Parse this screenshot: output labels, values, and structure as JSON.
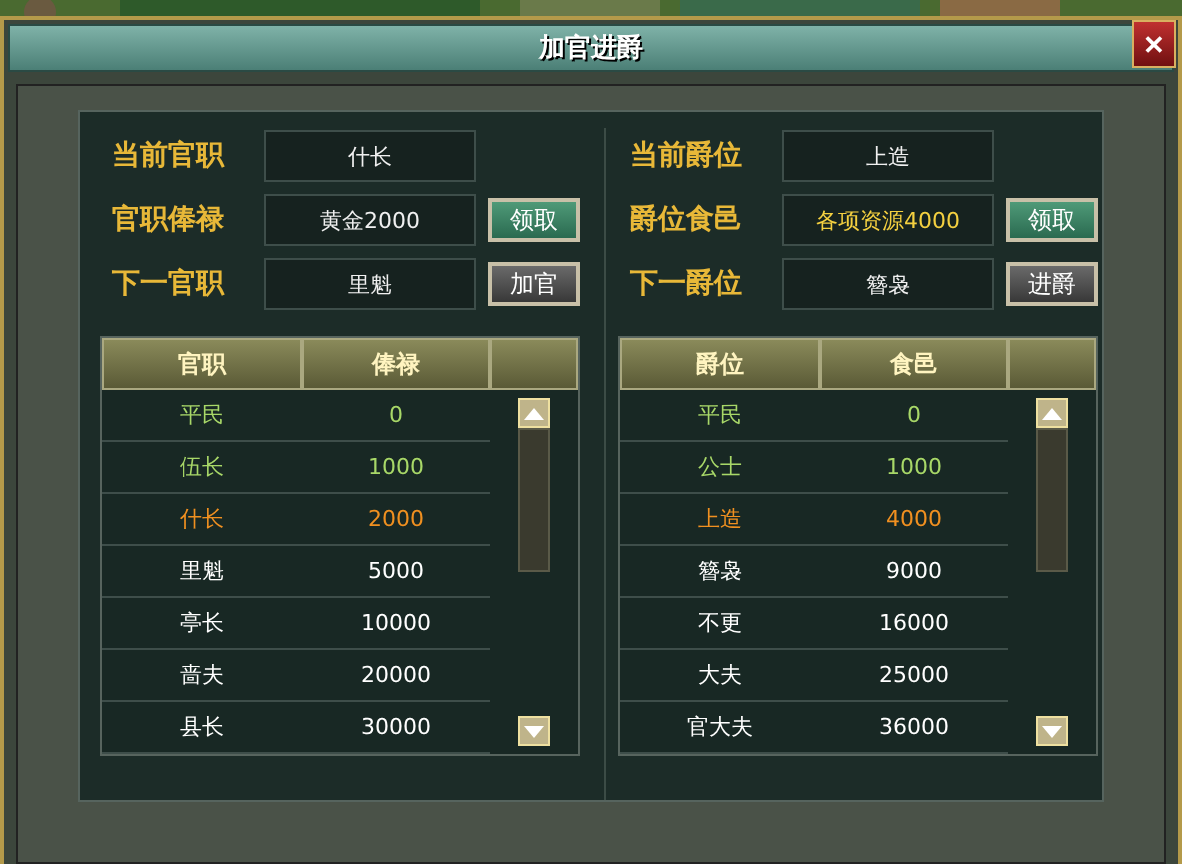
{
  "window": {
    "title": "加官进爵",
    "close": "✕"
  },
  "panels": [
    {
      "fields": [
        {
          "label": "当前官职",
          "value": "什长",
          "highlighted": false
        },
        {
          "label": "官职俸禄",
          "value": "黄金2000",
          "highlighted": false,
          "button": {
            "label": "领取",
            "highlighted": true
          }
        },
        {
          "label": "下一官职",
          "value": "里魁",
          "highlighted": false,
          "button": {
            "label": "加官",
            "highlighted": false
          }
        }
      ],
      "table": {
        "columns": [
          "官职",
          "俸禄"
        ],
        "rows": [
          {
            "cells": [
              "平民",
              "0"
            ],
            "kind": "passed"
          },
          {
            "cells": [
              "伍长",
              "1000"
            ],
            "kind": "passed"
          },
          {
            "cells": [
              "什长",
              "2000"
            ],
            "kind": "current"
          },
          {
            "cells": [
              "里魁",
              "5000"
            ],
            "kind": "locked"
          },
          {
            "cells": [
              "亭长",
              "10000"
            ],
            "kind": "locked"
          },
          {
            "cells": [
              "啬夫",
              "20000"
            ],
            "kind": "locked"
          },
          {
            "cells": [
              "县长",
              "30000"
            ],
            "kind": "locked"
          }
        ]
      }
    },
    {
      "fields": [
        {
          "label": "当前爵位",
          "value": "上造",
          "highlighted": false
        },
        {
          "label": "爵位食邑",
          "value": "各项资源4000",
          "highlighted": true,
          "button": {
            "label": "领取",
            "highlighted": true
          }
        },
        {
          "label": "下一爵位",
          "value": "簪袅",
          "highlighted": false,
          "button": {
            "label": "进爵",
            "highlighted": false
          }
        }
      ],
      "table": {
        "columns": [
          "爵位",
          "食邑"
        ],
        "rows": [
          {
            "cells": [
              "平民",
              "0"
            ],
            "kind": "passed"
          },
          {
            "cells": [
              "公士",
              "1000"
            ],
            "kind": "passed"
          },
          {
            "cells": [
              "上造",
              "4000"
            ],
            "kind": "current"
          },
          {
            "cells": [
              "簪袅",
              "9000"
            ],
            "kind": "locked"
          },
          {
            "cells": [
              "不更",
              "16000"
            ],
            "kind": "locked"
          },
          {
            "cells": [
              "大夫",
              "25000"
            ],
            "kind": "locked"
          },
          {
            "cells": [
              "官大夫",
              "36000"
            ],
            "kind": "locked"
          }
        ]
      }
    }
  ]
}
